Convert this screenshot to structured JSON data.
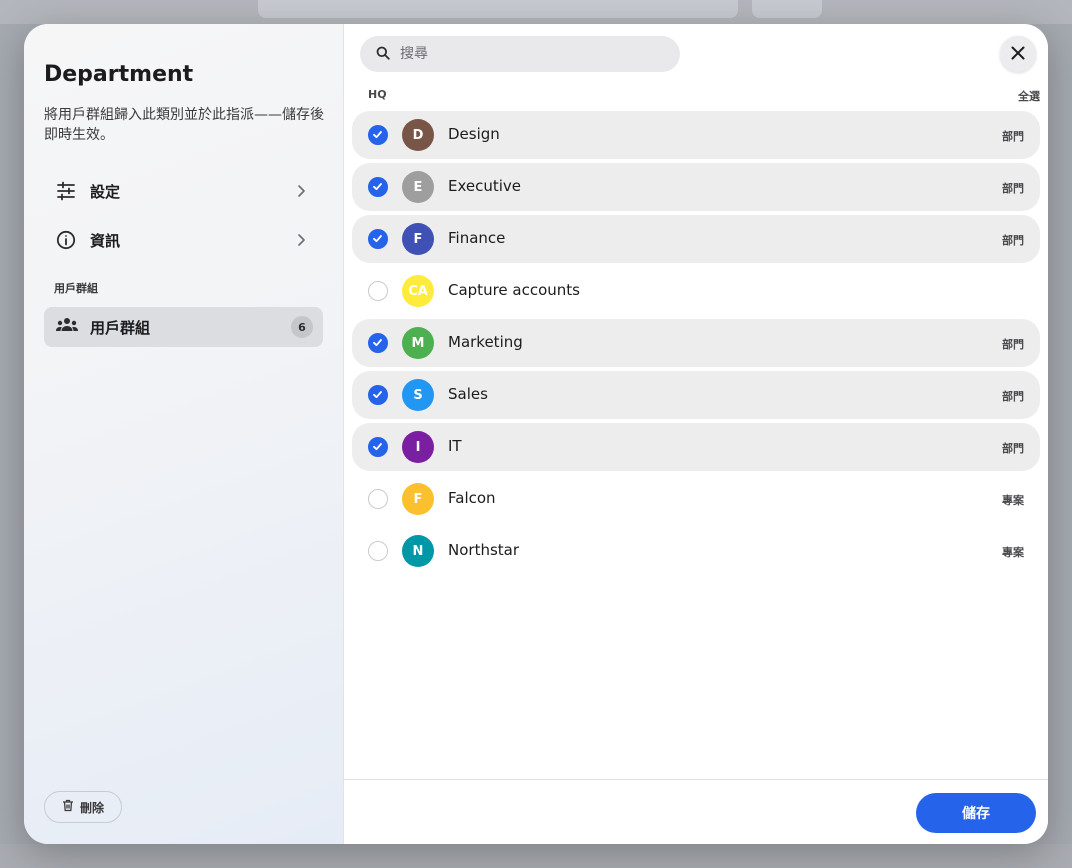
{
  "colors": {
    "accent": "#2563eb",
    "row_selected_bg": "#ededee"
  },
  "sidebar": {
    "title": "Department",
    "description": "將用戶群組歸入此類別並於此指派——儲存後即時生效。",
    "nav": [
      {
        "label": "設定",
        "icon": "sliders-icon"
      },
      {
        "label": "資訊",
        "icon": "info-icon"
      }
    ],
    "section_label": "用戶群組",
    "group_item": {
      "label": "用戶群組",
      "count": "6",
      "icon": "group-icon"
    },
    "delete_label": "刪除"
  },
  "search": {
    "placeholder": "搜尋",
    "value": ""
  },
  "list": {
    "header": "HQ",
    "select_all": "全選",
    "rows": [
      {
        "initials": "D",
        "name": "Design",
        "tag": "部門",
        "checked": true,
        "avatar_color": "#795548"
      },
      {
        "initials": "E",
        "name": "Executive",
        "tag": "部門",
        "checked": true,
        "avatar_color": "#9e9e9e"
      },
      {
        "initials": "F",
        "name": "Finance",
        "tag": "部門",
        "checked": true,
        "avatar_color": "#3f51b5"
      },
      {
        "initials": "CA",
        "name": "Capture accounts",
        "tag": "",
        "checked": false,
        "avatar_color": "#ffeb3b"
      },
      {
        "initials": "M",
        "name": "Marketing",
        "tag": "部門",
        "checked": true,
        "avatar_color": "#4caf50"
      },
      {
        "initials": "S",
        "name": "Sales",
        "tag": "部門",
        "checked": true,
        "avatar_color": "#2196f3"
      },
      {
        "initials": "I",
        "name": "IT",
        "tag": "部門",
        "checked": true,
        "avatar_color": "#7b1fa2"
      },
      {
        "initials": "F",
        "name": "Falcon",
        "tag": "專案",
        "checked": false,
        "avatar_color": "#fbc02d"
      },
      {
        "initials": "N",
        "name": "Northstar",
        "tag": "專案",
        "checked": false,
        "avatar_color": "#0097a7"
      }
    ]
  },
  "footer": {
    "save_label": "儲存"
  }
}
